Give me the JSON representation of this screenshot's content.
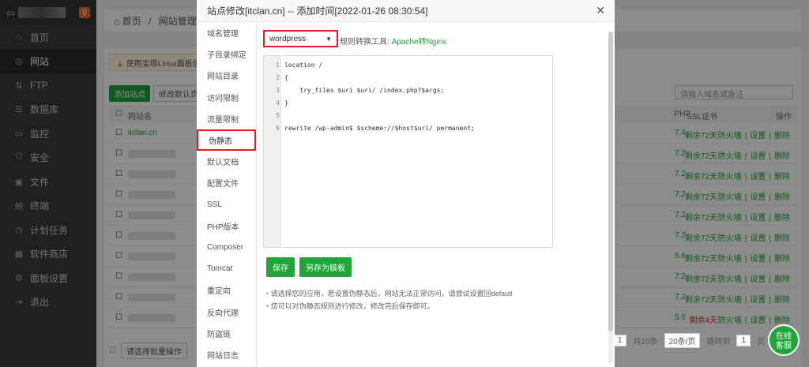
{
  "sidebar": {
    "badge": "0",
    "items": [
      {
        "label": "首页",
        "icon": "home-icon"
      },
      {
        "label": "网站",
        "icon": "globe-icon",
        "active": true
      },
      {
        "label": "FTP",
        "icon": "ftp-icon"
      },
      {
        "label": "数据库",
        "icon": "database-icon"
      },
      {
        "label": "监控",
        "icon": "monitor-icon"
      },
      {
        "label": "安全",
        "icon": "shield-icon"
      },
      {
        "label": "文件",
        "icon": "folder-icon"
      },
      {
        "label": "终端",
        "icon": "terminal-icon"
      },
      {
        "label": "计划任务",
        "icon": "clock-icon"
      },
      {
        "label": "软件商店",
        "icon": "grid-icon"
      },
      {
        "label": "面板设置",
        "icon": "gear-icon"
      },
      {
        "label": "退出",
        "icon": "logout-icon"
      }
    ]
  },
  "background": {
    "breadcrumb_home": "首页",
    "breadcrumb_sep": "/",
    "breadcrumb_current": "网站管理",
    "warning": "使用宝塔Linux面板创建",
    "add_site": "添加站点",
    "modify_default": "修改默认页",
    "search_placeholder": "请输入域名或备注",
    "col_name": "网站名",
    "col_php": "PHP",
    "col_ssl": "SSL证书",
    "col_ops": "操作",
    "first_site": "itclan.cn",
    "rows": [
      {
        "php": "7.4",
        "ssl": "剩余72天",
        "ssl_status": "ok"
      },
      {
        "php": "7.2",
        "ssl": "剩余72天",
        "ssl_status": "ok"
      },
      {
        "php": "7.2",
        "ssl": "剩余72天",
        "ssl_status": "ok"
      },
      {
        "php": "7.2",
        "ssl": "剩余72天",
        "ssl_status": "ok"
      },
      {
        "php": "7.2",
        "ssl": "剩余72天",
        "ssl_status": "ok"
      },
      {
        "php": "7.2",
        "ssl": "剩余72天",
        "ssl_status": "ok"
      },
      {
        "php": "5.6",
        "ssl": "剩余72天",
        "ssl_status": "ok"
      },
      {
        "php": "7.2",
        "ssl": "剩余72天",
        "ssl_status": "ok"
      },
      {
        "php": "7.2",
        "ssl": "剩余72天",
        "ssl_status": "ok"
      },
      {
        "php": "5.6",
        "ssl": "剩余4天",
        "ssl_status": "warn"
      }
    ],
    "ops_firewall": "防火墙",
    "ops_sep": "|",
    "ops_settings": "设置",
    "ops_delete": "删除",
    "batch_placeholder": "请选择批量操作",
    "pager_total": "共10条",
    "pager_size": "20条/页",
    "pager_goto": "跳转到",
    "pager_page": "1",
    "pager_unit": "页",
    "chat_line1": "在线",
    "chat_line2": "客服"
  },
  "modal": {
    "title": "站点修改[itclan.cn] -- 添加时间[2022-01-26 08:30:54]",
    "close": "✕",
    "tabs": [
      {
        "label": "域名管理"
      },
      {
        "label": "子目录绑定"
      },
      {
        "label": "网站目录"
      },
      {
        "label": "访问限制"
      },
      {
        "label": "流量限制"
      },
      {
        "label": "伪静态",
        "active": true
      },
      {
        "label": "默认文档"
      },
      {
        "label": "配置文件"
      },
      {
        "label": "SSL"
      },
      {
        "label": "PHP版本"
      },
      {
        "label": "Composer"
      },
      {
        "label": "Tomcat"
      },
      {
        "label": "重定向"
      },
      {
        "label": "反向代理"
      },
      {
        "label": "防盗链"
      },
      {
        "label": "网站日志"
      }
    ],
    "select_value": "wordpress",
    "tool_label": "规则转换工具:",
    "tool_link": "Apache转Nginx",
    "code_lines": [
      {
        "num": "1",
        "text": "location /"
      },
      {
        "num": "2",
        "text": "{"
      },
      {
        "num": "3",
        "text": "    try_files $uri $uri/ /index.php?$args;"
      },
      {
        "num": "4",
        "text": "}"
      },
      {
        "num": "5",
        "text": ""
      },
      {
        "num": "6",
        "text": "rewrite /wp-admin$ $scheme://$host$uri/ permanent;"
      }
    ],
    "save_button": "保存",
    "save_template_button": "另存为模板",
    "notes": [
      "请选择您的应用，若设置伪静态后，网站无法正常访问，请尝试设置回default",
      "您可以对伪静态规则进行修改，修改完后保存即可。"
    ]
  },
  "colors": {
    "accent_green": "#20a53a",
    "highlight_red": "#e02020",
    "sidebar_bg": "#3b3b3b"
  }
}
